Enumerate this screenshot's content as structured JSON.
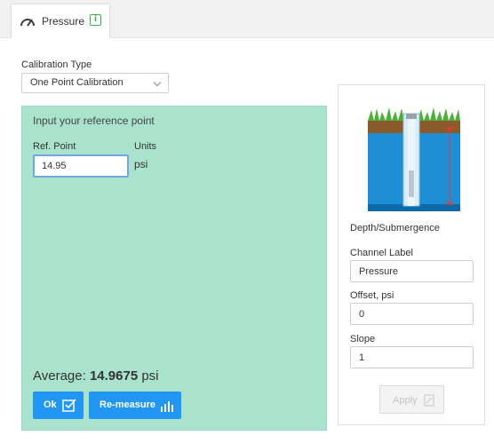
{
  "tab": {
    "label": "Pressure",
    "icon": "gauge-icon",
    "info_icon": "info-icon",
    "info_glyph": "i"
  },
  "calibration": {
    "label": "Calibration Type",
    "selected": "One Point Calibration"
  },
  "reference": {
    "title": "Input your reference point",
    "ref_label": "Ref. Point",
    "ref_value": "14.95",
    "units_label": "Units",
    "units_value": "psi",
    "average_label": "Average:",
    "average_value": "14.9675",
    "average_unit": "psi",
    "ok_label": "Ok",
    "remeasure_label": "Re-measure"
  },
  "sensor": {
    "caption": "Depth/Submergence",
    "channel_label": "Channel Label",
    "channel_value": "Pressure",
    "offset_label": "Offset, psi",
    "offset_value": "0",
    "slope_label": "Slope",
    "slope_value": "1",
    "apply_label": "Apply"
  },
  "colors": {
    "panel_green": "#a9e3cd",
    "button_blue": "#2196f3",
    "info_green": "#3bb34a"
  }
}
